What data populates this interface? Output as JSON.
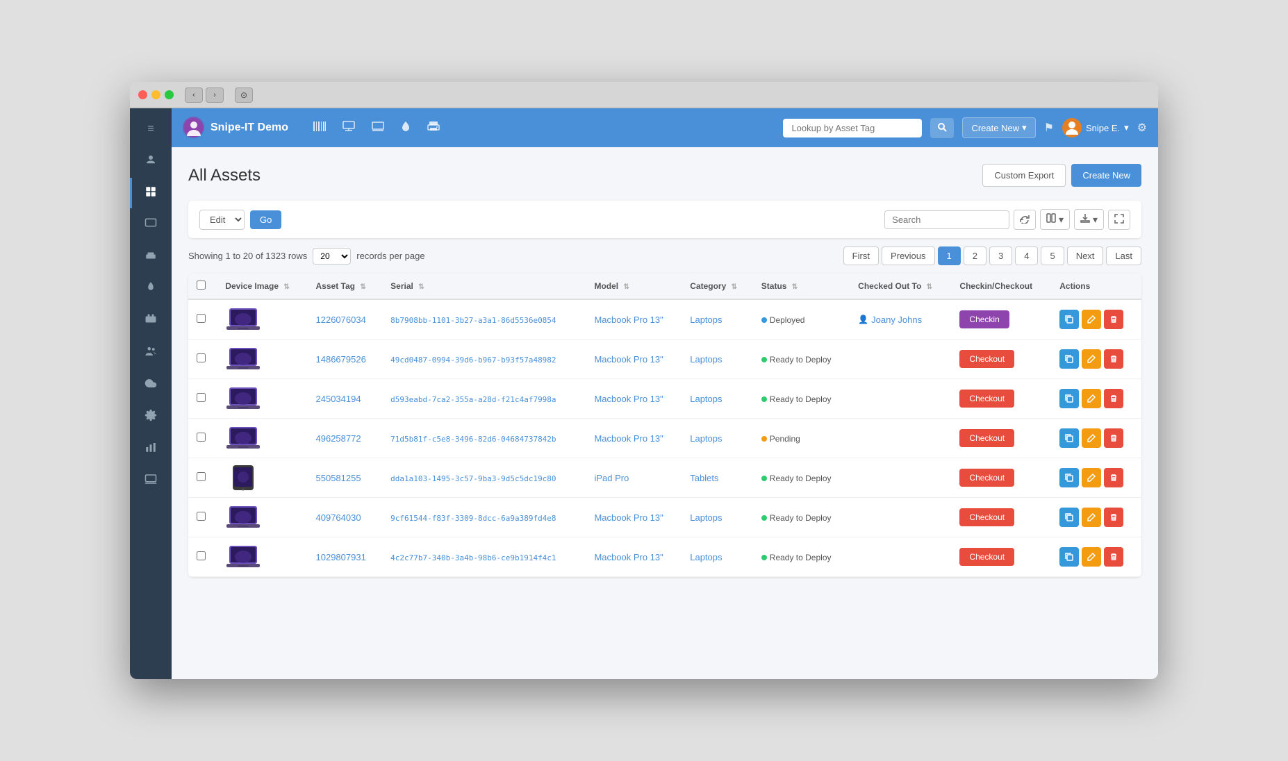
{
  "window": {
    "title": "Snipe-IT Demo"
  },
  "navbar": {
    "brand": "Snipe-IT Demo",
    "search_placeholder": "Lookup by Asset Tag",
    "create_new_label": "Create New",
    "user_label": "Snipe E.",
    "icons": [
      "barcode-icon",
      "computer-icon",
      "screen-icon",
      "droplet-icon",
      "print-icon"
    ]
  },
  "page": {
    "title": "All Assets",
    "custom_export_label": "Custom Export",
    "create_new_label": "Create New"
  },
  "toolbar": {
    "edit_label": "Edit",
    "go_label": "Go",
    "search_placeholder": "Search",
    "showing_text": "Showing 1 to 20 of 1323 rows",
    "per_page": "20",
    "records_per_page_label": "records per page"
  },
  "pagination": {
    "first_label": "First",
    "previous_label": "Previous",
    "next_label": "Next",
    "last_label": "Last",
    "pages": [
      "1",
      "2",
      "3",
      "4",
      "5"
    ],
    "active_page": "1"
  },
  "table": {
    "columns": [
      {
        "key": "device_image",
        "label": "Device Image"
      },
      {
        "key": "asset_tag",
        "label": "Asset Tag"
      },
      {
        "key": "serial",
        "label": "Serial"
      },
      {
        "key": "model",
        "label": "Model"
      },
      {
        "key": "category",
        "label": "Category"
      },
      {
        "key": "status",
        "label": "Status"
      },
      {
        "key": "checked_out_to",
        "label": "Checked Out To"
      },
      {
        "key": "checkin_checkout",
        "label": "Checkin/Checkout"
      },
      {
        "key": "actions",
        "label": "Actions"
      }
    ],
    "rows": [
      {
        "id": 1,
        "device_type": "laptop",
        "asset_tag": "1226076034",
        "serial": "8b7908bb-1101-3b27-a3a1-86d5536e0854",
        "model": "Macbook Pro 13\"",
        "category": "Laptops",
        "status": "Deployed",
        "status_type": "deployed",
        "checked_out_to": "Joany Johns",
        "has_user": true,
        "checkin_checkout_type": "checkin"
      },
      {
        "id": 2,
        "device_type": "laptop",
        "asset_tag": "1486679526",
        "serial": "49cd0487-0994-39d6-b967-b93f57a48982",
        "model": "Macbook Pro 13\"",
        "category": "Laptops",
        "status": "Ready to Deploy",
        "status_type": "ready",
        "checked_out_to": "",
        "has_user": false,
        "checkin_checkout_type": "checkout"
      },
      {
        "id": 3,
        "device_type": "laptop",
        "asset_tag": "245034194",
        "serial": "d593eabd-7ca2-355a-a28d-f21c4af7998a",
        "model": "Macbook Pro 13\"",
        "category": "Laptops",
        "status": "Ready to Deploy",
        "status_type": "ready",
        "checked_out_to": "",
        "has_user": false,
        "checkin_checkout_type": "checkout"
      },
      {
        "id": 4,
        "device_type": "laptop",
        "asset_tag": "496258772",
        "serial": "71d5b81f-c5e8-3496-82d6-04684737842b",
        "model": "Macbook Pro 13\"",
        "category": "Laptops",
        "status": "Pending",
        "status_type": "pending",
        "checked_out_to": "",
        "has_user": false,
        "checkin_checkout_type": "checkout"
      },
      {
        "id": 5,
        "device_type": "tablet",
        "asset_tag": "550581255",
        "serial": "dda1a103-1495-3c57-9ba3-9d5c5dc19c80",
        "model": "iPad Pro",
        "category": "Tablets",
        "status": "Ready to Deploy",
        "status_type": "ready",
        "checked_out_to": "",
        "has_user": false,
        "checkin_checkout_type": "checkout"
      },
      {
        "id": 6,
        "device_type": "laptop",
        "asset_tag": "409764030",
        "serial": "9cf61544-f83f-3309-8dcc-6a9a389fd4e8",
        "model": "Macbook Pro 13\"",
        "category": "Laptops",
        "status": "Ready to Deploy",
        "status_type": "ready",
        "checked_out_to": "",
        "has_user": false,
        "checkin_checkout_type": "checkout"
      },
      {
        "id": 7,
        "device_type": "laptop",
        "asset_tag": "1029807931",
        "serial": "4c2c77b7-340b-3a4b-98b6-ce9b1914f4c1",
        "model": "Macbook Pro 13\"",
        "category": "Laptops",
        "status": "Ready to Deploy",
        "status_type": "ready",
        "checked_out_to": "",
        "has_user": false,
        "checkin_checkout_type": "checkout"
      }
    ]
  },
  "sidebar": {
    "items": [
      {
        "key": "menu",
        "icon": "≡"
      },
      {
        "key": "dashboard",
        "icon": "👤"
      },
      {
        "key": "assets",
        "icon": "▦",
        "active": true
      },
      {
        "key": "licenses",
        "icon": "🖥"
      },
      {
        "key": "accessories",
        "icon": "⌨"
      },
      {
        "key": "consumables",
        "icon": "💧"
      },
      {
        "key": "components",
        "icon": "🖨"
      },
      {
        "key": "people",
        "icon": "👥"
      },
      {
        "key": "cloud",
        "icon": "☁"
      },
      {
        "key": "settings",
        "icon": "⚙"
      },
      {
        "key": "reports",
        "icon": "📊"
      },
      {
        "key": "laptop",
        "icon": "💻"
      }
    ]
  }
}
